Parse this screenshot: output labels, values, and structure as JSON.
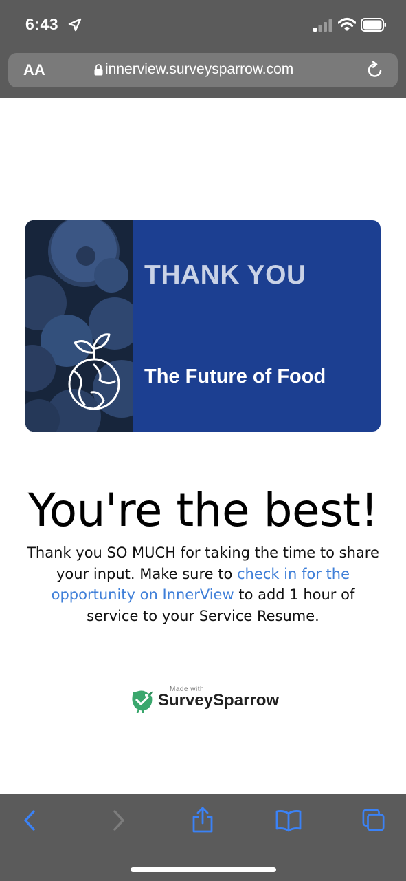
{
  "status_bar": {
    "time": "6:43",
    "icons": [
      "location-arrow-icon",
      "cellular-signal-icon",
      "wifi-icon",
      "battery-icon"
    ]
  },
  "browser": {
    "text_size_label": "AA",
    "url": "innerview.surveysparrow.com",
    "icons": [
      "lock-icon",
      "reload-icon"
    ]
  },
  "banner": {
    "title": "THANK YOU",
    "subtitle": "The Future of Food",
    "background_color": "#1c3f91",
    "image": "blueberries-photo-with-globe-sprout-icon"
  },
  "content": {
    "headline": "You're the best!",
    "message_before_link": "Thank you SO MUCH for taking the time to share your input. Make sure to ",
    "link_text": "check in for the opportunity on InnerView",
    "message_after_link": " to add 1 hour of service to your Service Resume.",
    "link_color": "#3f7fd8"
  },
  "footer": {
    "made_with": "Made with",
    "brand": "SurveySparrow",
    "brand_color": "#3aa76d"
  },
  "toolbar": {
    "icons": [
      "back-icon",
      "forward-icon",
      "share-icon",
      "bookmarks-icon",
      "tabs-icon"
    ],
    "accent_color": "#3b82f6"
  }
}
